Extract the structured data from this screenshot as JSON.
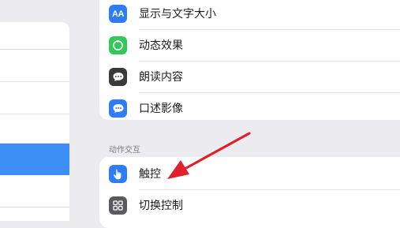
{
  "vision_group": {
    "items": [
      {
        "label": "显示与文字大小",
        "icon": "text-size-icon",
        "icon_text": "AA",
        "color": "#2f7df6"
      },
      {
        "label": "动态效果",
        "icon": "motion-icon",
        "color": "#34c759"
      },
      {
        "label": "朗读内容",
        "icon": "speech-bubble-icon",
        "color": "#3a3a3c"
      },
      {
        "label": "口述影像",
        "icon": "audio-description-icon",
        "color": "#2f7df6"
      }
    ]
  },
  "interaction_section": {
    "header": "动作交互",
    "items": [
      {
        "label": "触控",
        "icon": "hand-tap-icon",
        "color": "#2f7df6"
      },
      {
        "label": "切换控制",
        "icon": "switch-control-grid-icon",
        "color": "#5a5a5e"
      }
    ]
  },
  "sidebar": {
    "selected_color": "#3d8ff5"
  },
  "annotation": {
    "arrow_color": "#e0212c"
  }
}
